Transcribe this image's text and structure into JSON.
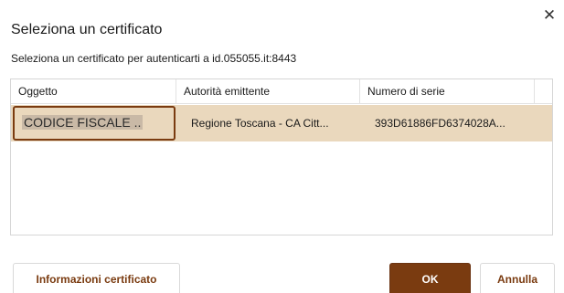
{
  "dialog": {
    "title": "Seleziona un certificato",
    "close_glyph": "✕",
    "close_icon": "close-icon",
    "subtitle": "Seleziona un certificato per autenticarti a id.055055.it:8443"
  },
  "table": {
    "columns": [
      "Oggetto",
      "Autorità emittente",
      "Numero di serie"
    ],
    "rows": [
      {
        "subject": "CODICE FISCALE ..",
        "issuer": "Regione Toscana - CA Citt...",
        "serial": "393D61886FD6374028A...",
        "selected": true
      }
    ]
  },
  "buttons": {
    "info_label": "Informazioni certificato",
    "ok_label": "OK",
    "cancel_label": "Annulla"
  },
  "colors": {
    "accent": "#7a3b10",
    "selected_row": "#ead8bd"
  }
}
